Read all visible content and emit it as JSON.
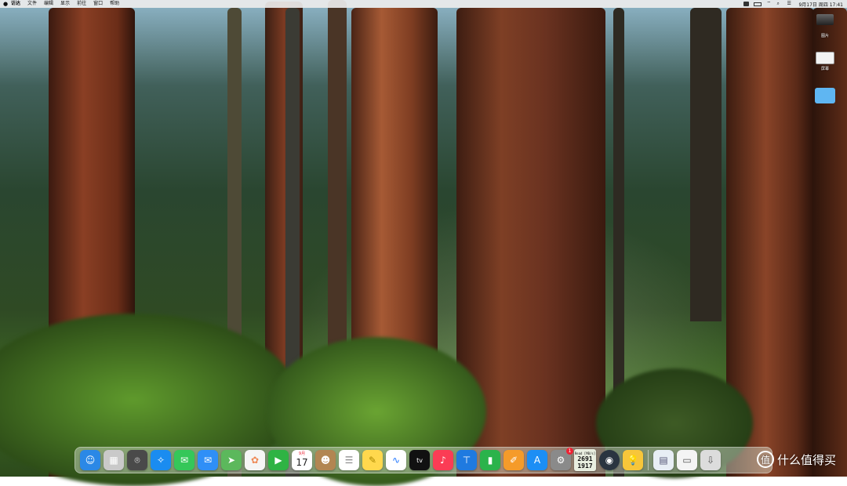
{
  "menubar": {
    "app_name": "访达",
    "items": [
      "文件",
      "编辑",
      "显示",
      "前往",
      "窗口",
      "帮助"
    ],
    "clock": "9月17日 周四 17:41"
  },
  "desktop": {
    "icons": [
      {
        "label": "",
        "icon": "screenshot-file-icon"
      },
      {
        "label": "图片",
        "icon": "image-file-icon"
      },
      {
        "label": "屏幕",
        "icon": "screenshot-file-icon"
      },
      {
        "label": "",
        "icon": "folder-icon"
      }
    ]
  },
  "dock": {
    "apps": [
      {
        "name": "finder",
        "color": "#2b88e6"
      },
      {
        "name": "launchpad",
        "color": "#c9c9c9"
      },
      {
        "name": "screenshot",
        "color": "#4a4a4a"
      },
      {
        "name": "safari",
        "color": "#1a8cf0"
      },
      {
        "name": "messages",
        "color": "#35c759"
      },
      {
        "name": "mail",
        "color": "#2f8ff7"
      },
      {
        "name": "maps",
        "color": "#5cb85c"
      },
      {
        "name": "photos",
        "color": "#f5f5f5"
      },
      {
        "name": "facetime",
        "color": "#2fb344"
      },
      {
        "name": "calendar",
        "color": "#ffffff",
        "month": "9月",
        "day": "17"
      },
      {
        "name": "contacts",
        "color": "#b28652"
      },
      {
        "name": "reminders",
        "color": "#ffffff"
      },
      {
        "name": "notes",
        "color": "#ffd84d"
      },
      {
        "name": "freeform",
        "color": "#ffffff"
      },
      {
        "name": "apple-tv",
        "color": "#111111",
        "text": "tv"
      },
      {
        "name": "music",
        "color": "#fb3c55"
      },
      {
        "name": "keynote",
        "color": "#1f7ae0"
      },
      {
        "name": "numbers",
        "color": "#2bb34b"
      },
      {
        "name": "pages",
        "color": "#f59b2a"
      },
      {
        "name": "app-store",
        "color": "#1c8ef5"
      },
      {
        "name": "system-settings",
        "color": "#8a8a8a",
        "badge": "1"
      }
    ],
    "disk_widget": {
      "header": "Read [MB/s]",
      "read": "2691",
      "write": "1917"
    },
    "extra_apps": [
      {
        "name": "globe",
        "color": "#2a3440"
      },
      {
        "name": "tips",
        "color": "#f7c63a"
      }
    ],
    "files": [
      {
        "name": "document",
        "color": "#e8eef5"
      },
      {
        "name": "window",
        "color": "#f4f4f4"
      },
      {
        "name": "downloads",
        "color": "#dcdcdc"
      }
    ]
  },
  "watermark": {
    "text": "什么值得买",
    "logo": "值"
  }
}
